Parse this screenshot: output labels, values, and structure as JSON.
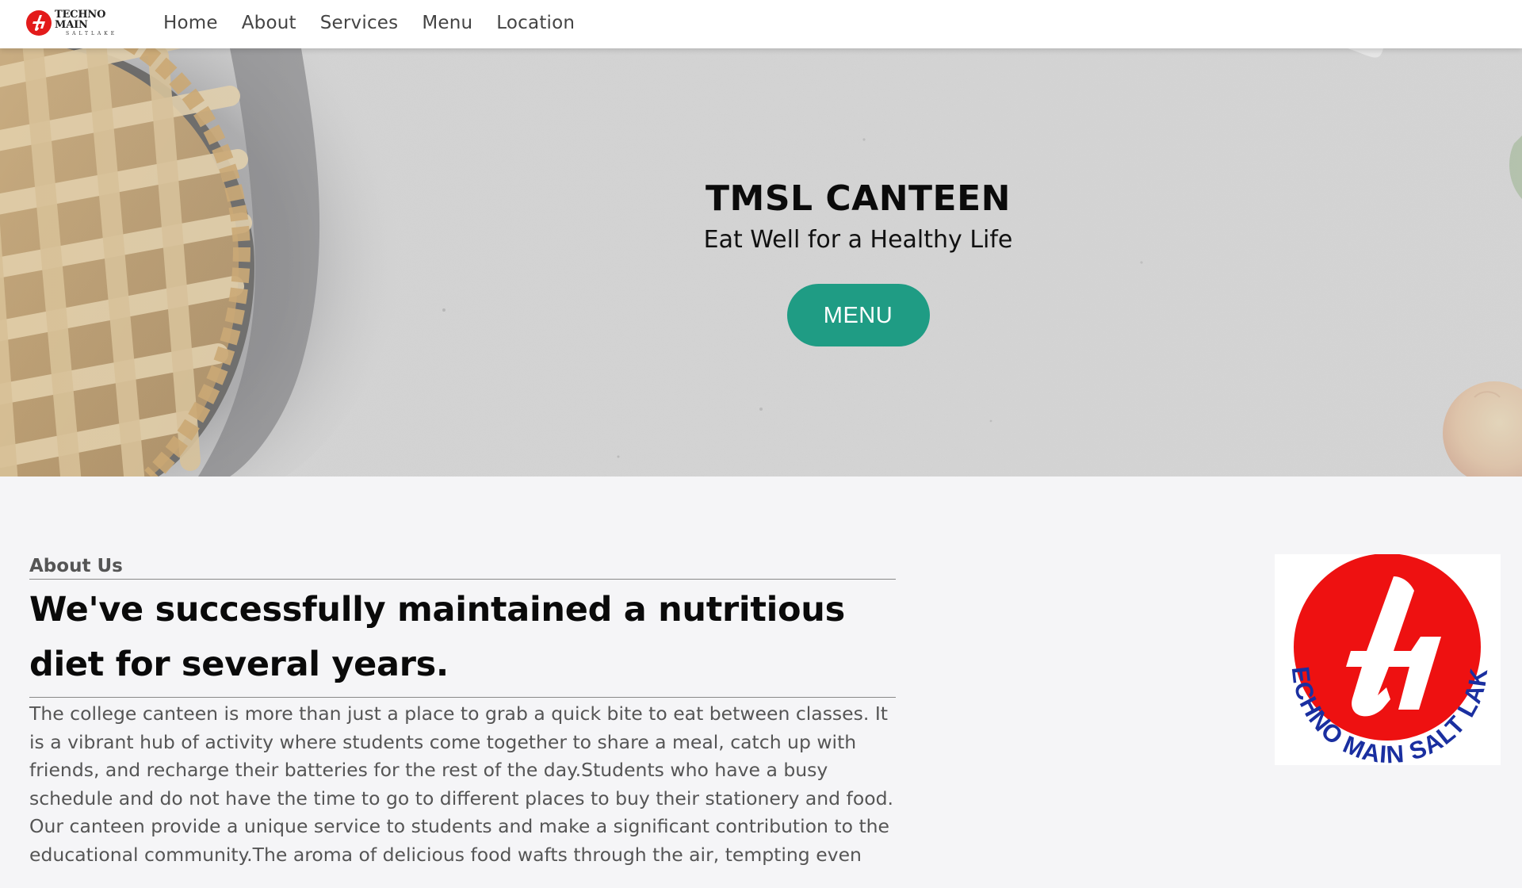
{
  "navbar": {
    "brand_title": "TECHNO MAIN",
    "brand_sub": "SALTLAKE",
    "links": [
      "Home",
      "About",
      "Services",
      "Menu",
      "Location"
    ]
  },
  "hero": {
    "title": "TMSL CANTEEN",
    "tagline": "Eat Well for a Healthy Life",
    "button_label": "MENU",
    "button_color": "#1f9c84"
  },
  "about": {
    "kicker": "About Us",
    "heading": "We've successfully maintained a nutritious diet for several years.",
    "body": "The college canteen is more than just a place to grab a quick bite to eat between classes. It is a vibrant hub of activity where students come together to share a meal, catch up with friends, and recharge their batteries for the rest of the day.Students who have a busy schedule and do not have the time to go to different places to buy their stationery and food. Our canteen provide a unique service to students and make a significant contribution to the educational community.The aroma of delicious food wafts through the air, tempting even",
    "logo_ring_text": "TECHNO MAIN SALT LAKE"
  },
  "colors": {
    "logo_red": "#e31b1b",
    "logo_blue": "#1a2fa0",
    "accent_green": "#1f9c84"
  },
  "icons": {
    "brand_logo": "techno-main-logo-icon",
    "about_logo": "techno-main-saltlake-logo-icon",
    "hero_image": "lattice-pie-image"
  }
}
